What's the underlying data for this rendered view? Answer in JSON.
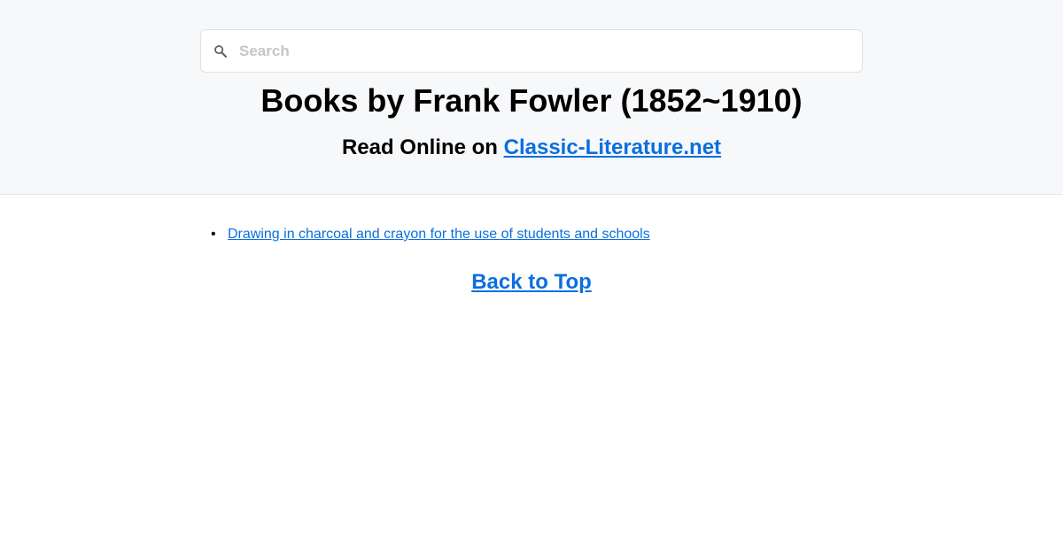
{
  "search": {
    "placeholder": "Search",
    "icon": "search-icon"
  },
  "header": {
    "title": "Books by Frank Fowler (1852~1910)",
    "subtitle_prefix": "Read Online on ",
    "site_link": "Classic-Literature.net"
  },
  "books": [
    {
      "title": "Drawing in charcoal and crayon for the use of students and schools"
    }
  ],
  "footer": {
    "back_to_top": "Back to Top"
  },
  "colors": {
    "link": "#0b6fde",
    "header_bg": "#f7f8fa",
    "text": "#000000"
  }
}
